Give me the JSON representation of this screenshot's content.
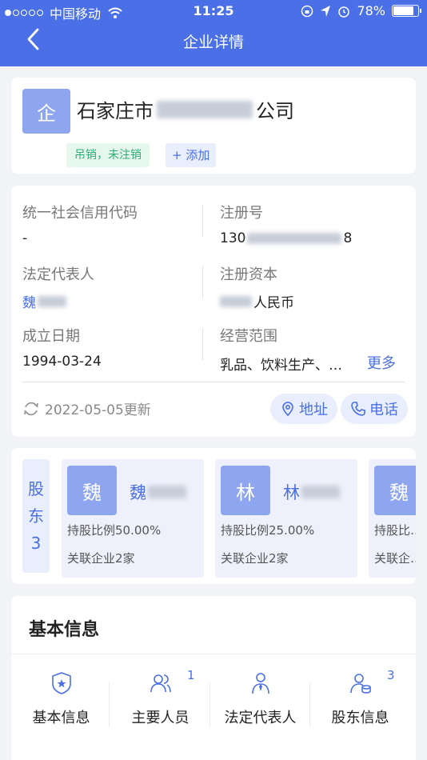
{
  "status_bar": {
    "carrier": "中国移动",
    "time": "11:25",
    "battery": "78%",
    "battery_level": 0.78
  },
  "nav": {
    "title": "企业详情"
  },
  "company": {
    "logo_char": "企",
    "name_prefix": "石家庄市",
    "name_suffix": "公司",
    "status_tag": "吊销，未注销",
    "add_tag": "+ 添加"
  },
  "info": {
    "credit_code_label": "统一社会信用代码",
    "credit_code_value": "-",
    "reg_no_label": "注册号",
    "reg_no_prefix": "130",
    "reg_no_suffix": "8",
    "legal_rep_label": "法定代表人",
    "legal_rep_value": "魏",
    "capital_label": "注册资本",
    "capital_value": "人民币",
    "founded_label": "成立日期",
    "founded_value": "1994-03-24",
    "scope_label": "经营范围",
    "scope_value": "乳品、饮料生产、…",
    "more": "更多",
    "updated": "2022-05-05更新",
    "address_btn": "地址",
    "phone_btn": "电话"
  },
  "shareholders": {
    "tab_chars": [
      "股",
      "东",
      "3"
    ],
    "items": [
      {
        "avatar": "魏",
        "name": "魏",
        "ratio": "持股比例50.00%",
        "related": "关联企业2家"
      },
      {
        "avatar": "林",
        "name": "林",
        "ratio": "持股比例25.00%",
        "related": "关联企业2家"
      },
      {
        "avatar": "魏",
        "name": "",
        "ratio": "持股比…",
        "related": "关联企…"
      }
    ]
  },
  "basic": {
    "title": "基本信息",
    "items": [
      {
        "label": "基本信息",
        "icon": "badge-icon",
        "count": ""
      },
      {
        "label": "主要人员",
        "icon": "people-icon",
        "count": "1"
      },
      {
        "label": "法定代表人",
        "icon": "person-tie-icon",
        "count": ""
      },
      {
        "label": "股东信息",
        "icon": "shareholder-icon",
        "count": "3"
      }
    ]
  },
  "colors": {
    "primary": "#4a6fe6",
    "avatar": "#8da6ef",
    "status_green": "#2eae73"
  }
}
